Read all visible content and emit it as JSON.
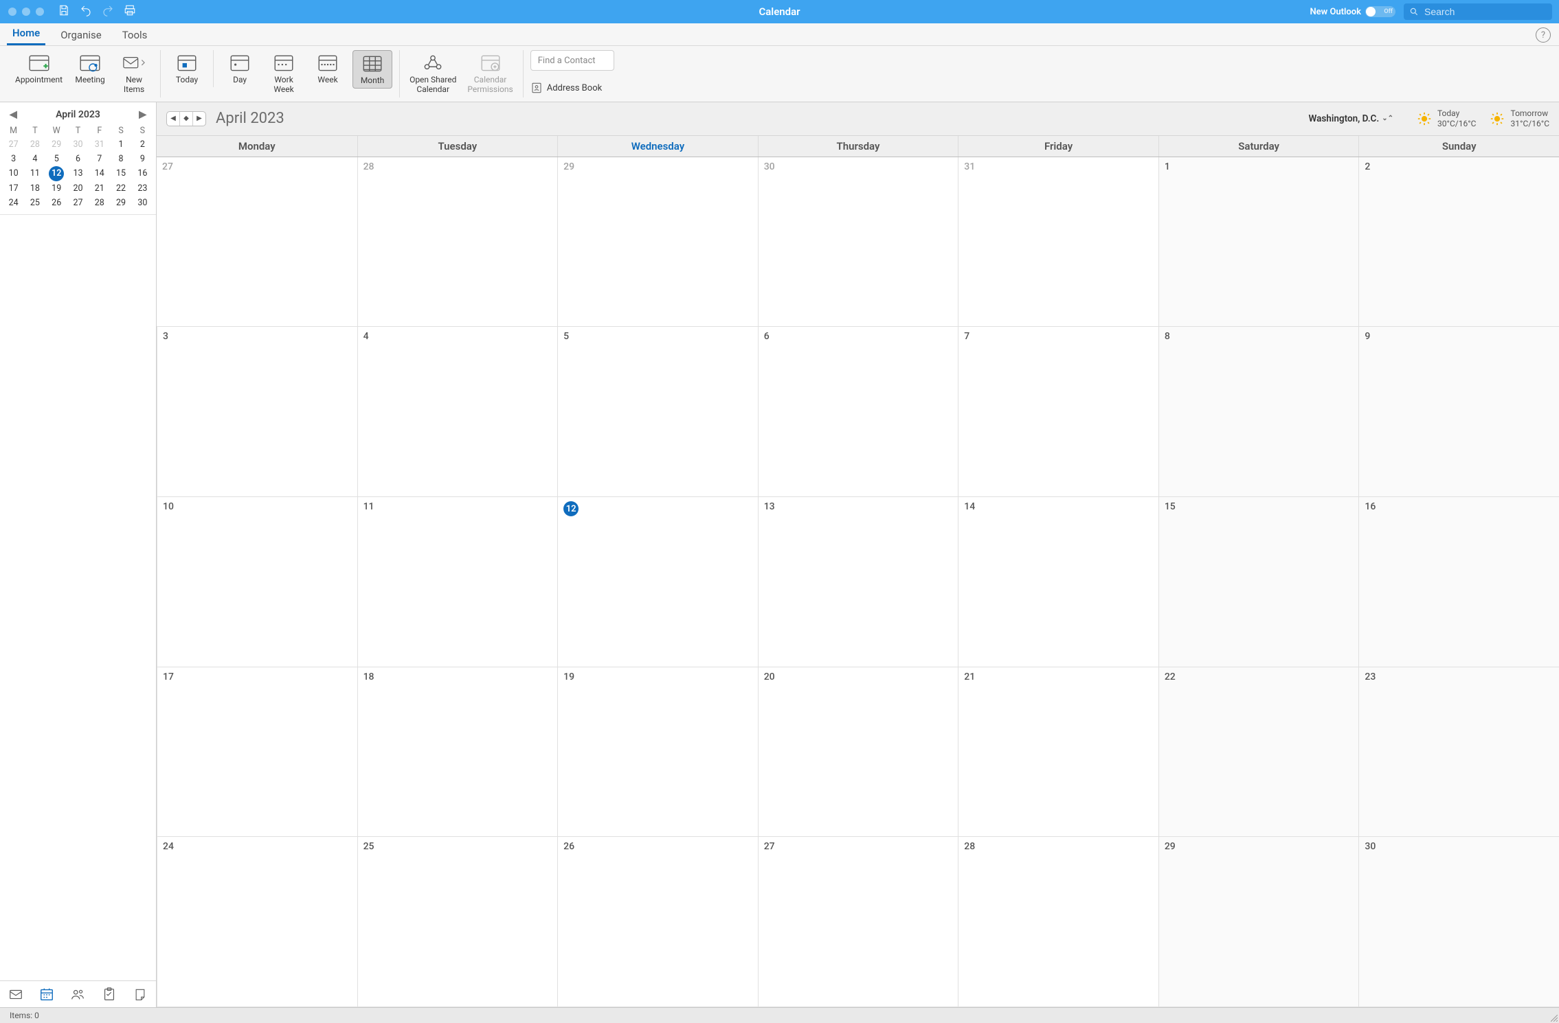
{
  "titlebar": {
    "title": "Calendar",
    "new_outlook_label": "New Outlook",
    "new_outlook_state": "Off",
    "search_placeholder": "Search"
  },
  "tabs": {
    "home": "Home",
    "organise": "Organise",
    "tools": "Tools",
    "active": "home"
  },
  "ribbon": {
    "appointment": "Appointment",
    "meeting": "Meeting",
    "new_items": "New\nItems",
    "today": "Today",
    "day": "Day",
    "work_week": "Work\nWeek",
    "week": "Week",
    "month": "Month",
    "open_shared": "Open Shared\nCalendar",
    "calendar_permissions": "Calendar\nPermissions",
    "find_contact": "Find a Contact",
    "address_book": "Address Book",
    "selected_view": "month"
  },
  "mini": {
    "title": "April 2023",
    "dow": [
      "M",
      "T",
      "W",
      "T",
      "F",
      "S",
      "S"
    ],
    "weeks": [
      [
        {
          "n": 27,
          "out": true
        },
        {
          "n": 28,
          "out": true
        },
        {
          "n": 29,
          "out": true
        },
        {
          "n": 30,
          "out": true
        },
        {
          "n": 31,
          "out": true
        },
        {
          "n": 1
        },
        {
          "n": 2
        }
      ],
      [
        {
          "n": 3
        },
        {
          "n": 4
        },
        {
          "n": 5
        },
        {
          "n": 6
        },
        {
          "n": 7
        },
        {
          "n": 8
        },
        {
          "n": 9
        }
      ],
      [
        {
          "n": 10
        },
        {
          "n": 11
        },
        {
          "n": 12,
          "today": true
        },
        {
          "n": 13
        },
        {
          "n": 14
        },
        {
          "n": 15
        },
        {
          "n": 16
        }
      ],
      [
        {
          "n": 17
        },
        {
          "n": 18
        },
        {
          "n": 19
        },
        {
          "n": 20
        },
        {
          "n": 21
        },
        {
          "n": 22
        },
        {
          "n": 23
        }
      ],
      [
        {
          "n": 24
        },
        {
          "n": 25
        },
        {
          "n": 26
        },
        {
          "n": 27
        },
        {
          "n": 28
        },
        {
          "n": 29
        },
        {
          "n": 30
        }
      ]
    ]
  },
  "main": {
    "title": "April 2023",
    "location": "Washington,  D.C.",
    "weather": [
      {
        "label": "Today",
        "temp": "30°C/16°C"
      },
      {
        "label": "Tomorrow",
        "temp": "31°C/16°C"
      }
    ],
    "dow": [
      "Monday",
      "Tuesday",
      "Wednesday",
      "Thursday",
      "Friday",
      "Saturday",
      "Sunday"
    ],
    "today_index": 2,
    "weeks": [
      [
        {
          "n": 27,
          "out": true
        },
        {
          "n": 28,
          "out": true
        },
        {
          "n": 29,
          "out": true
        },
        {
          "n": 30,
          "out": true
        },
        {
          "n": 31,
          "out": true
        },
        {
          "n": 1,
          "we": true
        },
        {
          "n": 2,
          "we": true
        }
      ],
      [
        {
          "n": 3
        },
        {
          "n": 4
        },
        {
          "n": 5
        },
        {
          "n": 6
        },
        {
          "n": 7
        },
        {
          "n": 8,
          "we": true
        },
        {
          "n": 9,
          "we": true
        }
      ],
      [
        {
          "n": 10
        },
        {
          "n": 11
        },
        {
          "n": 12,
          "today": true
        },
        {
          "n": 13
        },
        {
          "n": 14
        },
        {
          "n": 15,
          "we": true
        },
        {
          "n": 16,
          "we": true
        }
      ],
      [
        {
          "n": 17
        },
        {
          "n": 18
        },
        {
          "n": 19
        },
        {
          "n": 20
        },
        {
          "n": 21
        },
        {
          "n": 22,
          "we": true
        },
        {
          "n": 23,
          "we": true
        }
      ],
      [
        {
          "n": 24
        },
        {
          "n": 25
        },
        {
          "n": 26
        },
        {
          "n": 27
        },
        {
          "n": 28
        },
        {
          "n": 29,
          "we": true
        },
        {
          "n": 30,
          "we": true
        }
      ]
    ]
  },
  "status": {
    "items": "Items: 0"
  }
}
